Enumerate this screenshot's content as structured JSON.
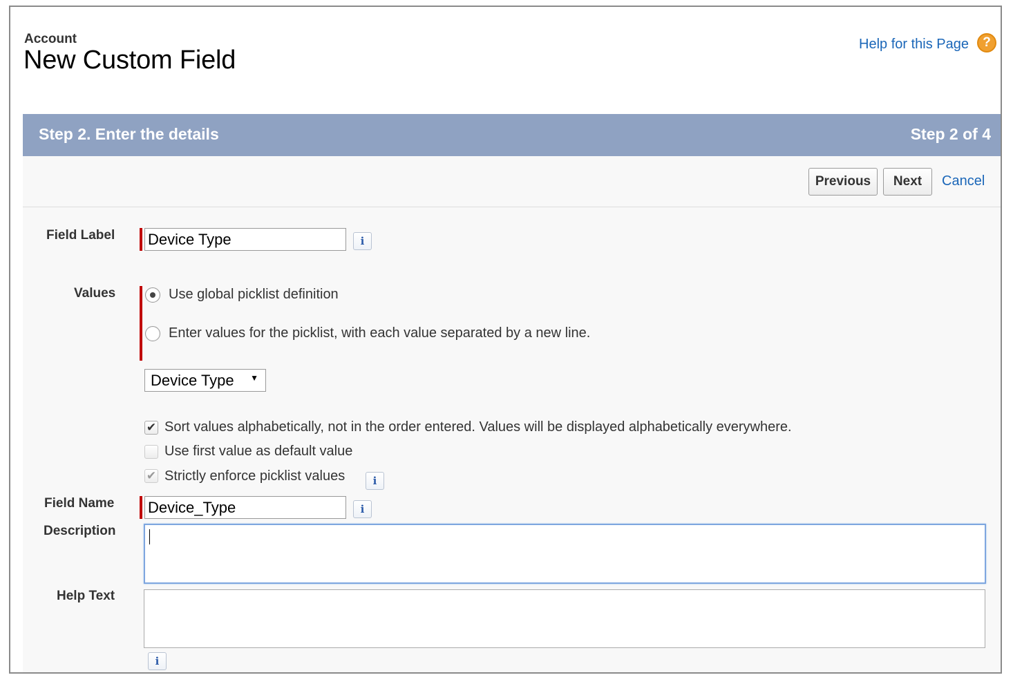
{
  "header": {
    "object_type": "Account",
    "title": "New Custom Field",
    "help_link": "Help for this Page",
    "help_icon_char": "?"
  },
  "step": {
    "title": "Step 2. Enter the details",
    "indicator": "Step 2 of 4"
  },
  "buttons": {
    "previous": "Previous",
    "next": "Next",
    "cancel": "Cancel"
  },
  "form": {
    "field_label": {
      "label": "Field Label",
      "value": "Device Type"
    },
    "values": {
      "label": "Values",
      "options": [
        {
          "text": "Use global picklist definition",
          "selected": true
        },
        {
          "text": "Enter values for the picklist, with each value separated by a new line.",
          "selected": false
        }
      ],
      "global_picklist_selected": "Device Type"
    },
    "checkboxes": [
      {
        "text": "Sort values alphabetically, not in the order entered. Values will be displayed alphabetically everywhere.",
        "checked": true,
        "disabled": false
      },
      {
        "text": "Use first value as default value",
        "checked": false,
        "disabled": false
      },
      {
        "text": "Strictly enforce picklist values",
        "checked": true,
        "disabled": true
      }
    ],
    "field_name": {
      "label": "Field Name",
      "value": "Device_Type"
    },
    "description": {
      "label": "Description",
      "value": ""
    },
    "help_text": {
      "label": "Help Text",
      "value": ""
    },
    "info_icon_char": "i"
  },
  "colors": {
    "header_bar": "#8fa2c2",
    "link": "#1a66b8",
    "required": "#c00000",
    "help_icon": "#f0a030"
  }
}
